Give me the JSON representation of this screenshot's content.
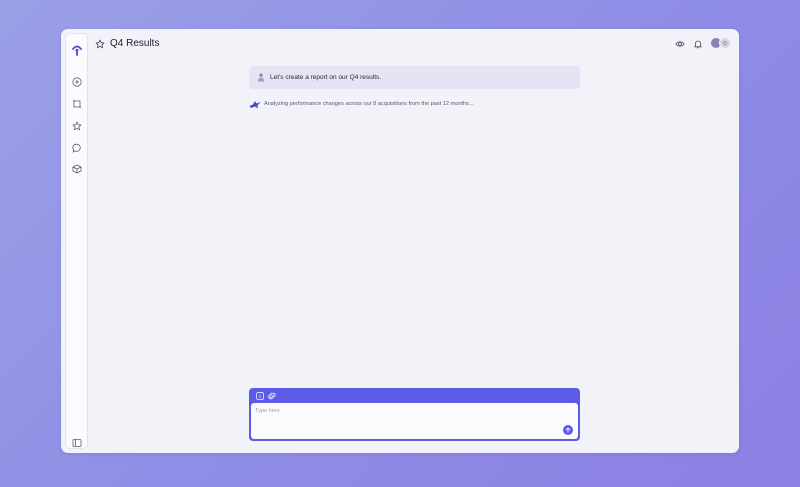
{
  "header": {
    "title": "Q4 Results"
  },
  "conversation": {
    "user_message": "Let's create a report on our Q4 results.",
    "assistant_status": "Analyzing performance changes across our 8 acquisitions from the past 12 months..."
  },
  "composer": {
    "placeholder": "Type here"
  },
  "colors": {
    "accent": "#5b5be8",
    "window_bg": "#f2f2f9",
    "user_bubble": "#e5e4f4",
    "icon": "#5a5a7a"
  },
  "icons": {
    "sidebar": [
      "app-logo-icon",
      "new-chat-icon",
      "crop-icon",
      "star-icon",
      "chat-bubble-icon",
      "box-icon",
      "sidebar-toggle-icon"
    ],
    "header": [
      "star-icon",
      "eye-icon",
      "bell-icon"
    ],
    "composer": [
      "info-icon",
      "paperclip-icon",
      "send-arrow-icon"
    ]
  }
}
